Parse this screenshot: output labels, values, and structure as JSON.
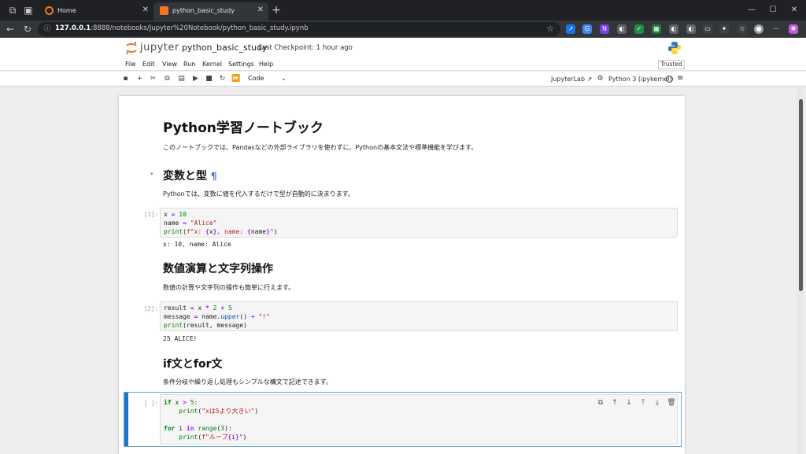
{
  "browser": {
    "tabs": [
      {
        "title": "Home",
        "active": false
      },
      {
        "title": "python_basic_study",
        "active": true
      }
    ],
    "url_host": "127.0.0.1",
    "url_rest": ":8888/notebooks/Jupyter%20Notebook/python_basic_study.ipynb"
  },
  "jupyter": {
    "brand": "jupyter",
    "notebook_name": "python_basic_study",
    "checkpoint": "Last Checkpoint: 1 hour ago",
    "menus": [
      "File",
      "Edit",
      "View",
      "Run",
      "Kernel",
      "Settings",
      "Help"
    ],
    "trusted": "Trusted",
    "cell_type": "Code",
    "jupyterlab_link": "JupyterLab",
    "kernel_name": "Python 3 (ipykernel)"
  },
  "notebook": {
    "title": "Python学習ノートブック",
    "intro": "このノートブックでは、Pandasなどの外部ライブラリを使わずに、Pythonの基本文法や標準機能を学びます。",
    "section1": {
      "heading": "変数と型",
      "pilcrow": "¶",
      "text": "Pythonでは、変数に値を代入するだけで型が自動的に決まります。",
      "prompt": "[1]:",
      "output": "x: 10, name: Alice"
    },
    "section2": {
      "heading": "数値演算と文字列操作",
      "text": "数値の計算や文字列の操作も簡単に行えます。",
      "prompt": "[2]:",
      "output": "25 ALICE!"
    },
    "section3": {
      "heading": "if文とfor文",
      "text": "条件分岐や繰り返し処理もシンプルな構文で記述できます。",
      "prompt": "[ ]:"
    }
  },
  "colors": {
    "browser_dark": "#202124",
    "accent_blue": "#1976d2",
    "jupyter_orange": "#f37726"
  }
}
